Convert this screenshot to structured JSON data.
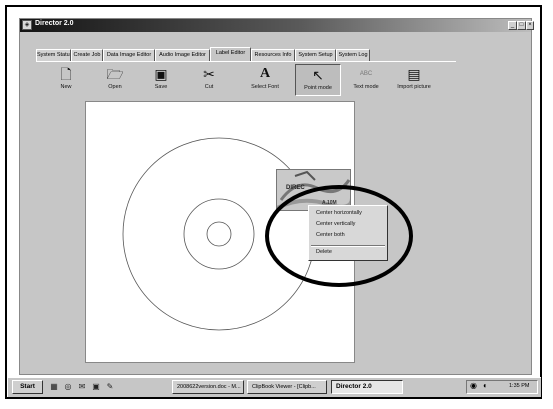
{
  "window": {
    "title": "Director 2.0",
    "controls": [
      "_",
      "□",
      "×"
    ]
  },
  "tabs": [
    "System Status",
    "Create Job",
    "Data Image Editor",
    "Audio Image Editor",
    "Label Editor",
    "Resources Info",
    "System Setup",
    "System Log"
  ],
  "active_tab": "Label Editor",
  "toolbar": [
    {
      "label": "New",
      "icon": "new-document-icon",
      "glyph": "🗋"
    },
    {
      "label": "Open",
      "icon": "open-folder-icon",
      "glyph": "🗁"
    },
    {
      "label": "Save",
      "icon": "floppy-disk-icon",
      "glyph": "▣"
    },
    {
      "label": "Cut",
      "icon": "scissors-icon",
      "glyph": "✂"
    },
    {
      "label": "Select Font",
      "icon": "font-icon",
      "glyph": "A"
    },
    {
      "label": "Point mode",
      "icon": "pointer-icon",
      "glyph": "↖"
    },
    {
      "label": "Text mode",
      "icon": "text-icon",
      "glyph": "ABC"
    },
    {
      "label": "Import picture",
      "icon": "picture-icon",
      "glyph": "▤"
    }
  ],
  "label_image": {
    "text": "DIREC",
    "subtext": "A.10M"
  },
  "context_menu": [
    "Center horizontally",
    "Center vertically",
    "Center both",
    "Delete"
  ],
  "taskbar": {
    "start": "Start",
    "tasks": [
      "2008622version.doc - M...",
      "ClipBook Viewer - [Clipb...",
      "Director 2.0"
    ],
    "active_task": "Director 2.0",
    "clock": "1:35 PM"
  },
  "colors": {
    "titlebar": "#141414",
    "window_bg": "#c6c6c6",
    "highlight_ring": "#000000"
  }
}
